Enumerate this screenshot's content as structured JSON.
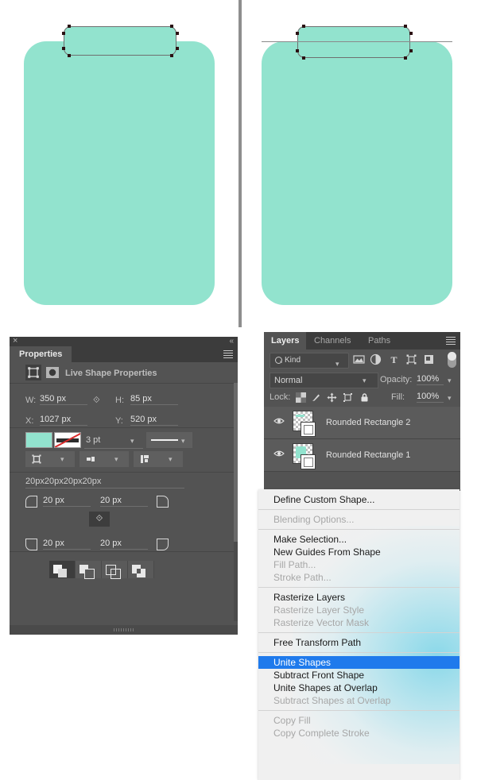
{
  "app": "Adobe Photoshop",
  "canvas": {
    "left_pane": {
      "name": "before-unite-canvas",
      "shape_color": "#92e3ce",
      "description": "Rounded rectangle body with separate small rounded rectangle clip on top, anchor points visible"
    },
    "right_pane": {
      "name": "after-unite-canvas",
      "shape_color": "#92e3ce",
      "description": "Same shapes united into one path, outline visible through body"
    }
  },
  "properties_panel": {
    "close_glyph": "×",
    "collapse_glyph": "«",
    "tab_label": "Properties",
    "menu_icon": "panel-menu-icon",
    "header_title": "Live Shape Properties",
    "header_icons": [
      "live-shape-icon",
      "mask-icon"
    ],
    "dimensions": {
      "w_label": "W:",
      "w_value": "350 px",
      "link_icon": "⟐",
      "h_label": "H:",
      "h_value": "85 px",
      "x_label": "X:",
      "x_value": "1027 px",
      "y_label": "Y:",
      "y_value": "520 px"
    },
    "stroke": {
      "fill_swatch_color": "#92e3ce",
      "stroke_swatch": "no-stroke",
      "stroke_width": "3 pt",
      "stroke_style": "solid-line",
      "align_option": "stroke-align",
      "caps_option": "stroke-caps",
      "corner_option": "stroke-corners"
    },
    "radii": {
      "summary": "20px20px20px20px",
      "top_left": "20 px",
      "top_right": "20 px",
      "bottom_left": "20 px",
      "bottom_right": "20 px",
      "link_glyph": "⟐"
    },
    "path_operations": [
      {
        "name": "unite-shapes",
        "active": true
      },
      {
        "name": "subtract-front-shape",
        "active": false
      },
      {
        "name": "intersect-shape-areas",
        "active": false
      },
      {
        "name": "exclude-overlapping-shapes",
        "active": false
      }
    ]
  },
  "layers_panel": {
    "tabs": [
      {
        "label": "Layers",
        "active": true
      },
      {
        "label": "Channels",
        "active": false
      },
      {
        "label": "Paths",
        "active": false
      }
    ],
    "menu_icon": "panel-menu-icon",
    "filter": {
      "kind_label": "Kind",
      "search_icon": "search-icon",
      "icons": [
        "pixel-layer-filter-icon",
        "adjustment-layer-filter-icon",
        "type-layer-filter-icon",
        "shape-layer-filter-icon",
        "smart-object-filter-icon"
      ],
      "toggle": "filter-enable-toggle"
    },
    "blend": {
      "mode": "Normal",
      "opacity_label": "Opacity:",
      "opacity_value": "100%"
    },
    "lock": {
      "label": "Lock:",
      "icons": [
        "lock-transparent-pixels-icon",
        "lock-image-pixels-icon",
        "lock-position-icon",
        "lock-artboard-nesting-icon",
        "lock-all-icon"
      ],
      "fill_label": "Fill:",
      "fill_value": "100%"
    },
    "layers": [
      {
        "name": "Rounded Rectangle 2",
        "visible": true,
        "eye_icon": "eye-icon",
        "thumb_color": "#92e3ce"
      },
      {
        "name": "Rounded Rectangle 1",
        "visible": true,
        "eye_icon": "eye-icon",
        "thumb_color": "#92e3ce"
      }
    ]
  },
  "context_menu": {
    "highlight_color": "#1f7aec",
    "items": [
      {
        "label": "Define Custom Shape...",
        "state": "enabled"
      },
      {
        "type": "separator"
      },
      {
        "label": "Blending Options...",
        "state": "disabled"
      },
      {
        "type": "separator"
      },
      {
        "label": "Make Selection...",
        "state": "enabled"
      },
      {
        "label": "New Guides From Shape",
        "state": "enabled"
      },
      {
        "label": "Fill Path...",
        "state": "disabled"
      },
      {
        "label": "Stroke Path...",
        "state": "disabled"
      },
      {
        "type": "separator"
      },
      {
        "label": "Rasterize Layers",
        "state": "enabled"
      },
      {
        "label": "Rasterize Layer Style",
        "state": "disabled"
      },
      {
        "label": "Rasterize Vector Mask",
        "state": "disabled"
      },
      {
        "type": "separator"
      },
      {
        "label": "Free Transform Path",
        "state": "enabled"
      },
      {
        "type": "separator"
      },
      {
        "label": "Unite Shapes",
        "state": "selected"
      },
      {
        "label": "Subtract Front Shape",
        "state": "enabled"
      },
      {
        "label": "Unite Shapes at Overlap",
        "state": "enabled"
      },
      {
        "label": "Subtract Shapes at Overlap",
        "state": "disabled"
      },
      {
        "type": "separator"
      },
      {
        "label": "Copy Fill",
        "state": "disabled"
      },
      {
        "label": "Copy Complete Stroke",
        "state": "disabled"
      }
    ]
  }
}
